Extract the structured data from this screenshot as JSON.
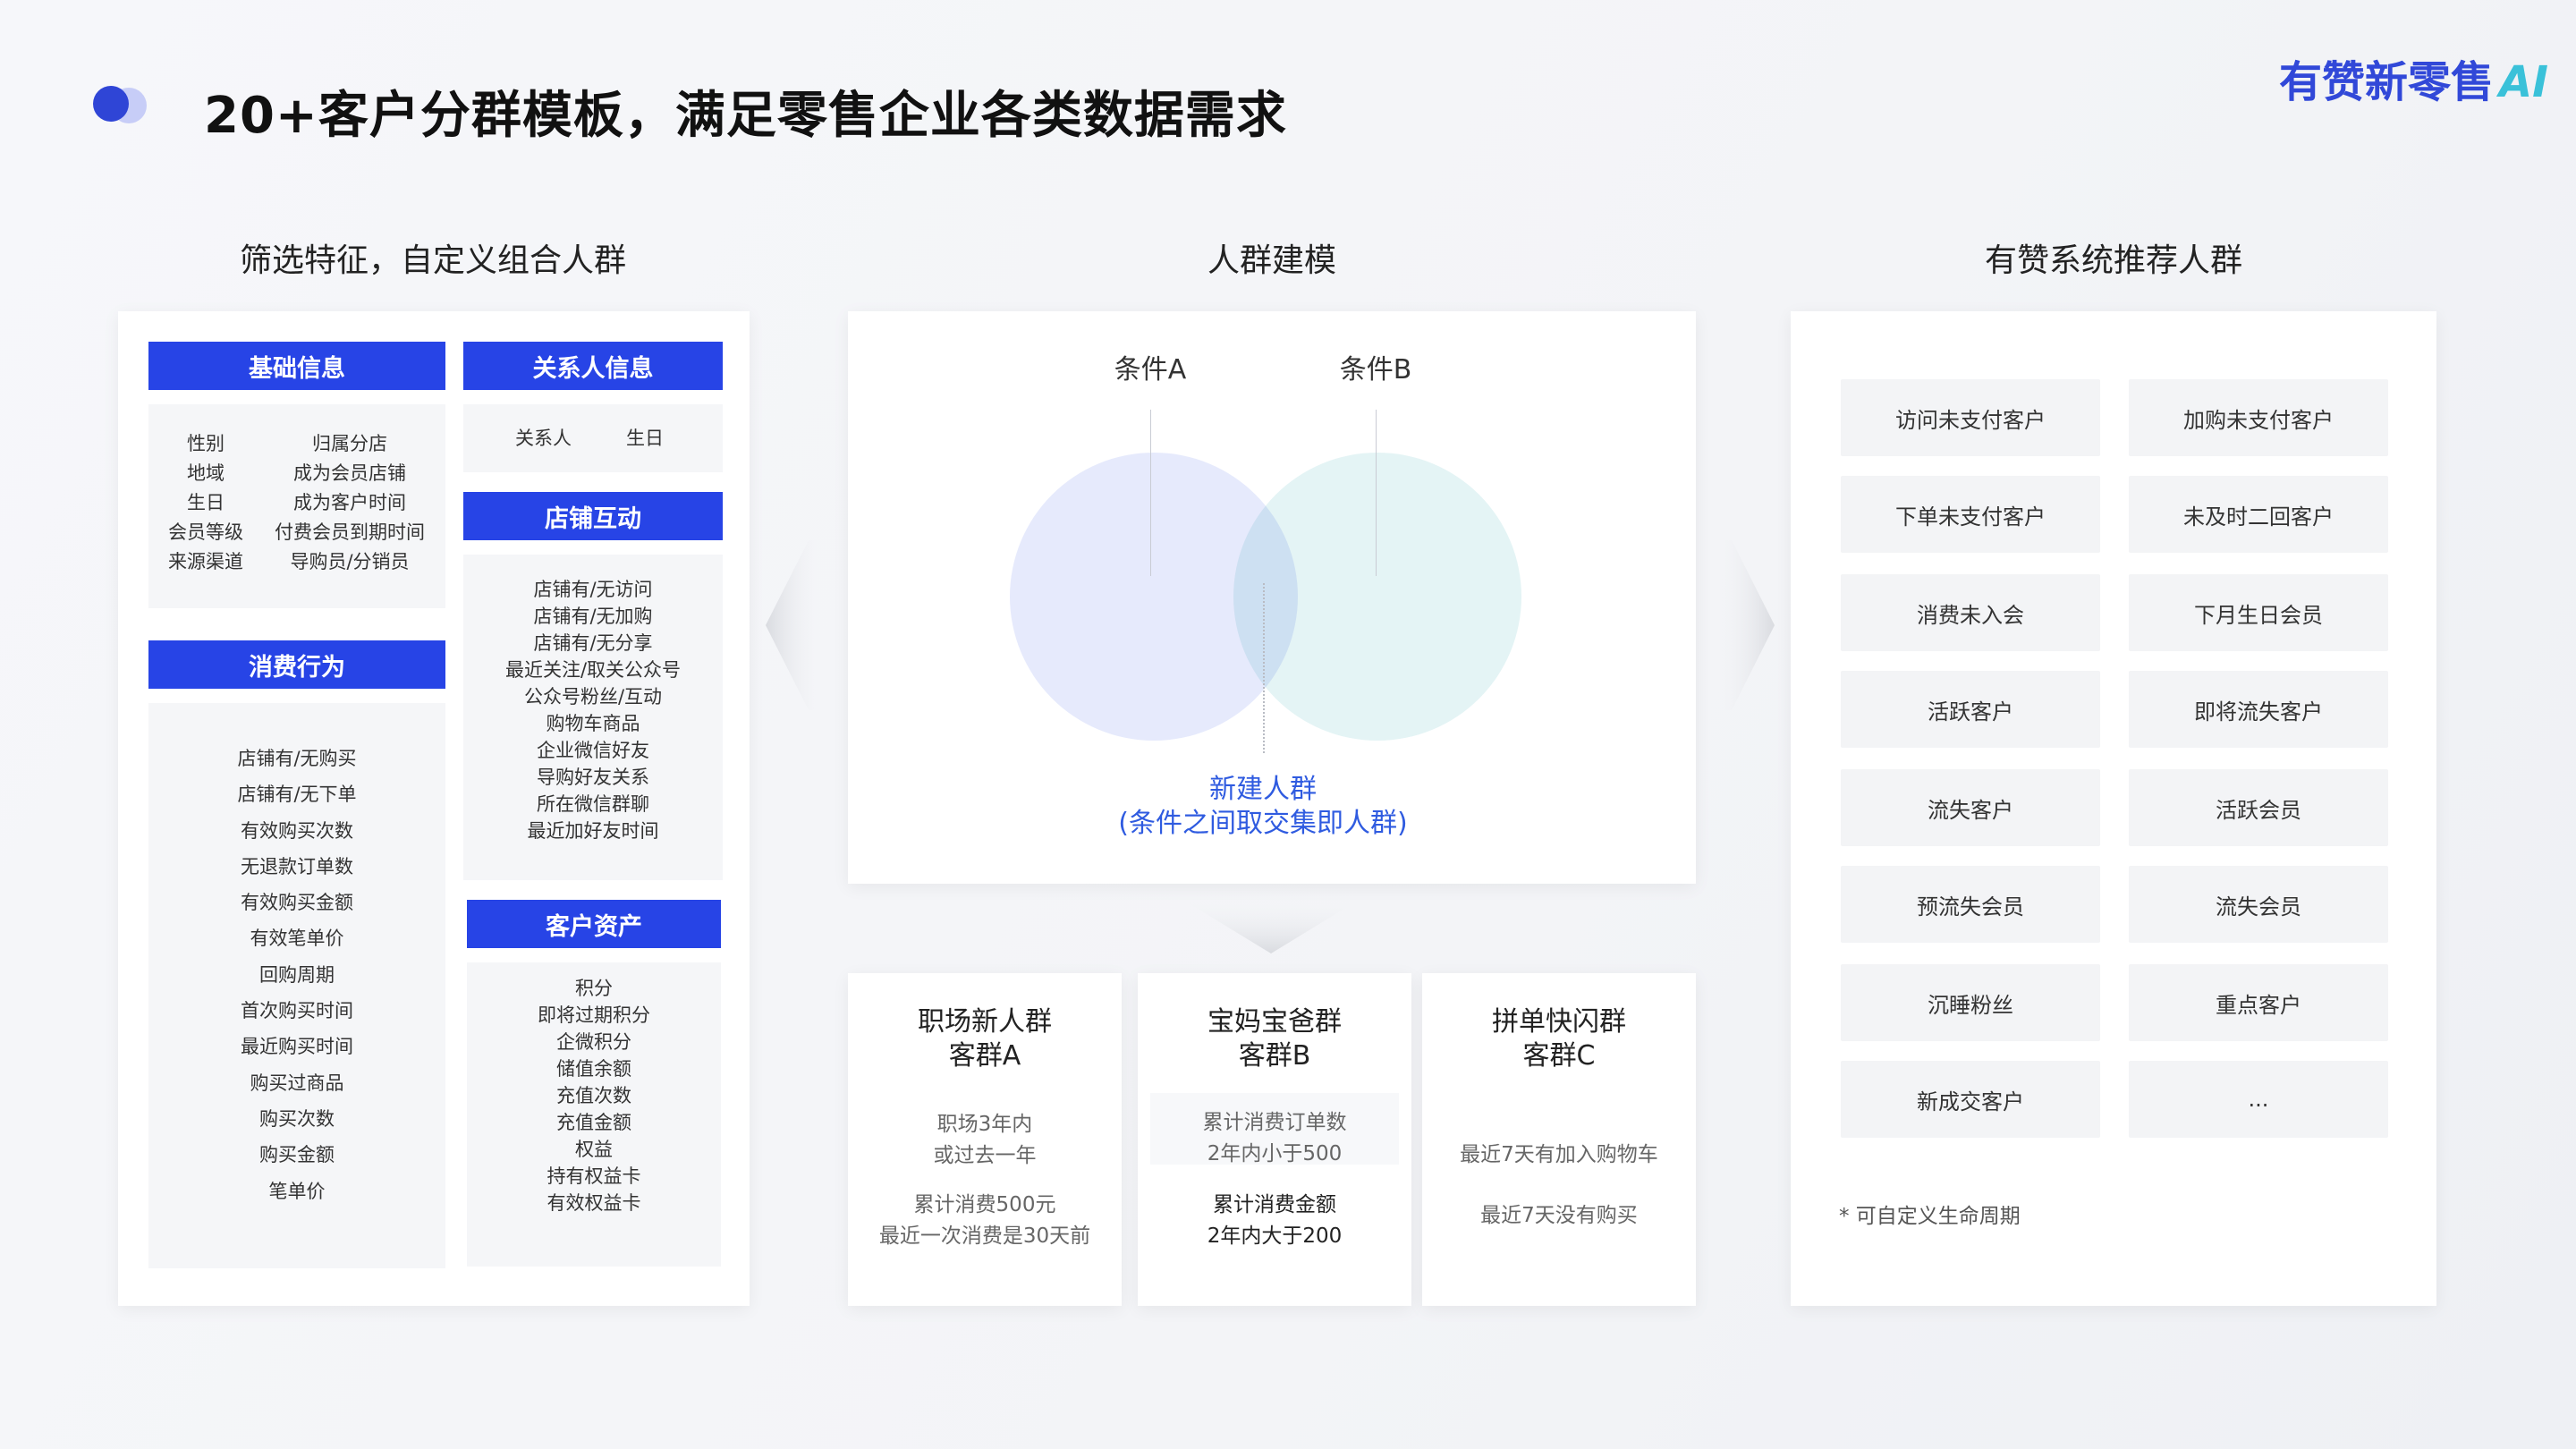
{
  "header": {
    "title": "20+客户分群模板，满足零售企业各类数据需求",
    "brand": "有赞新零售",
    "brand_ai": "AI"
  },
  "left": {
    "heading": "筛选特征，自定义组合人群",
    "basic": {
      "title": "基础信息",
      "col1": [
        "性别",
        "地域",
        "生日",
        "会员等级",
        "来源渠道"
      ],
      "col2": [
        "归属分店",
        "成为会员店铺",
        "成为客户时间",
        "付费会员到期时间",
        "导购员/分销员"
      ]
    },
    "relation": {
      "title": "关系人信息",
      "items": [
        "关系人",
        "生日"
      ]
    },
    "store": {
      "title": "店铺互动",
      "items": [
        "店铺有/无访问",
        "店铺有/无加购",
        "店铺有/无分享",
        "最近关注/取关公众号",
        "公众号粉丝/互动",
        "购物车商品",
        "企业微信好友",
        "导购好友关系",
        "所在微信群聊",
        "最近加好友时间"
      ]
    },
    "consume": {
      "title": "消费行为",
      "items": [
        "店铺有/无购买",
        "店铺有/无下单",
        "有效购买次数",
        "无退款订单数",
        "有效购买金额",
        "有效笔单价",
        "回购周期",
        "首次购买时间",
        "最近购买时间",
        "购买过商品",
        "购买次数",
        "购买金额",
        "笔单价"
      ]
    },
    "assets": {
      "title": "客户资产",
      "items": [
        "积分",
        "即将过期积分",
        "企微积分",
        "储值余额",
        "充值次数",
        "充值金额",
        "权益",
        "持有权益卡",
        "有效权益卡"
      ]
    }
  },
  "middle": {
    "heading": "人群建模",
    "cond_a": "条件A",
    "cond_b": "条件B",
    "new_group": "新建人群",
    "new_group_note": "(条件之间取交集即人群)",
    "colors": {
      "circle_a": "#e6eafc",
      "circle_b": "#e4f4f5"
    },
    "groups": [
      {
        "title": "职场新人群",
        "sub": "客群A",
        "lines1": [
          "职场3年内",
          "或过去一年"
        ],
        "lines2": [
          "累计消费500元",
          "最近一次消费是30天前"
        ]
      },
      {
        "title": "宝妈宝爸群",
        "sub": "客群B",
        "lines1": [
          "累计消费订单数",
          "2年内小于500"
        ],
        "lines2": [
          "累计消费金额",
          "2年内大于200"
        ]
      },
      {
        "title": "拼单快闪群",
        "sub": "客群C",
        "lines1": [
          "最近7天有加入购物车"
        ],
        "lines2": [
          "最近7天没有购买"
        ]
      }
    ]
  },
  "right": {
    "heading": "有赞系统推荐人群",
    "tags": [
      "访问未支付客户",
      "加购未支付客户",
      "下单未支付客户",
      "未及时二回客户",
      "消费未入会",
      "下月生日会员",
      "活跃客户",
      "即将流失客户",
      "流失客户",
      "活跃会员",
      "预流失会员",
      "流失会员",
      "沉睡粉丝",
      "重点客户",
      "新成交客户",
      "..."
    ],
    "note": "* 可自定义生命周期"
  }
}
